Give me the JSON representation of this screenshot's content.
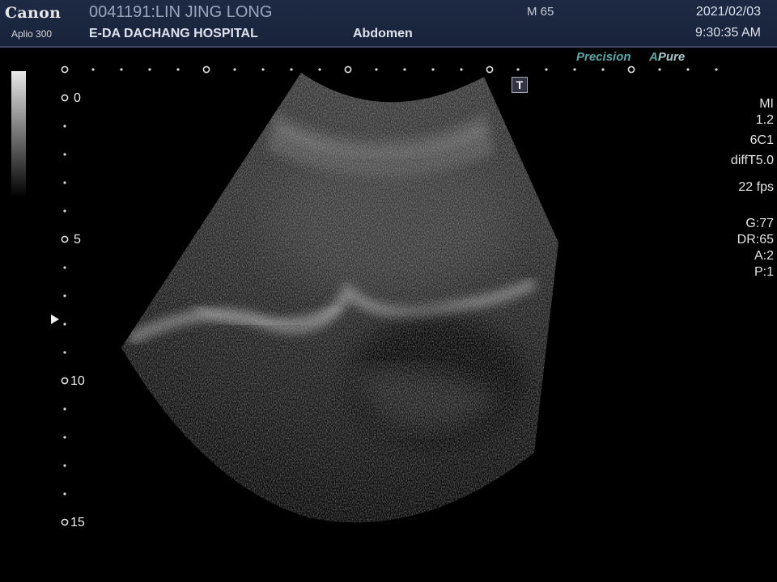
{
  "header": {
    "brand": "Canon",
    "model": "Aplio 300",
    "patient": "0041191:LIN JING LONG",
    "hospital": "E-DA DACHANG HOSPITAL",
    "exam": "Abdomen",
    "m_code": "M 65",
    "date": "2021/02/03",
    "time": "9:30:35 AM"
  },
  "badges": {
    "precision": "Precision",
    "apure_a": "A",
    "apure_rest": "Pure"
  },
  "t_icon": "T",
  "depth_scale": {
    "labels": [
      "0",
      "5",
      "10",
      "15"
    ],
    "unit": ""
  },
  "params": {
    "mi_label": "MI",
    "mi_value": "1.2",
    "probe": "6C1",
    "mode": "diffT5.0",
    "frame_rate": "22 fps",
    "gain": "G:77",
    "dynamic_range": "DR:65",
    "a": "A:2",
    "p": "P:1"
  },
  "colors": {
    "header_bg": "#1e2a44",
    "accent_teal": "#59a9a8"
  },
  "icons": {
    "focus": "right-triangle-focus-icon",
    "t_button": "T-mode-icon"
  }
}
